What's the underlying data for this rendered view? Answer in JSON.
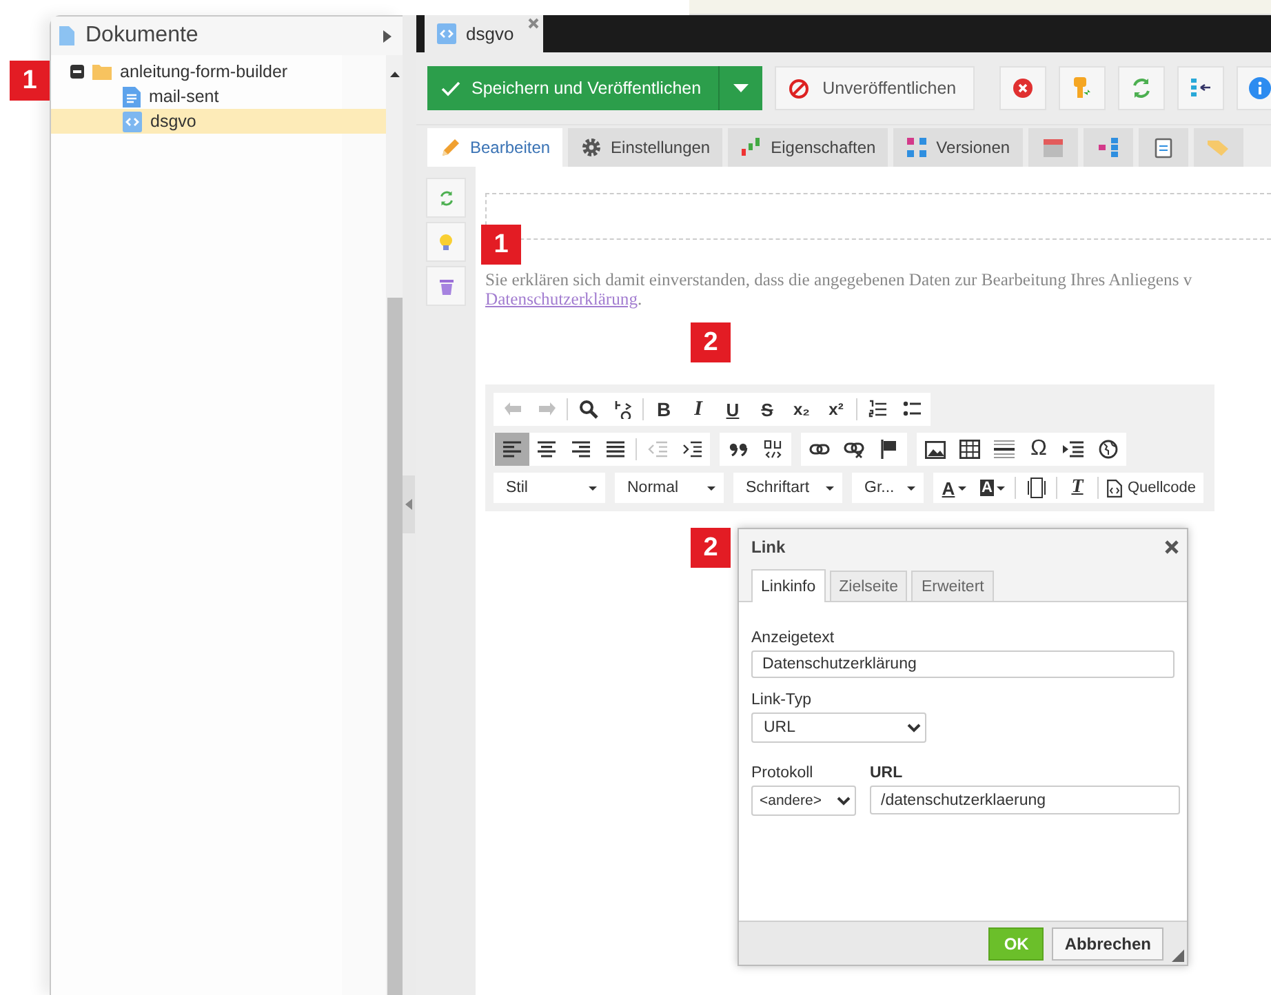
{
  "sidebar": {
    "title": "Dokumente",
    "tree": [
      {
        "label": "anleitung-form-builder",
        "kind": "folder",
        "expanded": true,
        "selected": false,
        "children": [
          {
            "label": "mail-sent",
            "kind": "page",
            "selected": false
          },
          {
            "label": "dsgvo",
            "kind": "snippet",
            "selected": true
          }
        ]
      }
    ]
  },
  "document_tabs": [
    {
      "label": "dsgvo",
      "kind": "snippet",
      "selected": true
    }
  ],
  "toolbar": {
    "save": "Speichern und Veröffentlichen",
    "unpublish": "Unveröffentlichen"
  },
  "tabs": [
    {
      "label": "Bearbeiten",
      "kind": "pencil",
      "selected": true
    },
    {
      "label": "Einstellungen",
      "kind": "gear",
      "selected": false
    },
    {
      "label": "Eigenschaften",
      "kind": "properties",
      "selected": false
    },
    {
      "label": "Versionen",
      "kind": "versions",
      "selected": false
    },
    {
      "kind": "calendar",
      "selected": false
    },
    {
      "kind": "hierarchy",
      "selected": false
    },
    {
      "kind": "clipboard",
      "selected": false
    },
    {
      "kind": "tag",
      "selected": false
    }
  ],
  "editor": {
    "text": "Sie erklären sich damit einverstanden, dass die angegebenen Daten zur Bearbeitung Ihres Anliegens v",
    "link": "Datenschutzerklärung",
    "after": ".",
    "toolbar_rows": [
      {
        "strips": [
          {
            "sections": [
              [
                {
                  "kind": "undo",
                  "disabled": true,
                  "selected": false
                },
                {
                  "kind": "redo",
                  "disabled": true,
                  "selected": false
                }
              ],
              [
                {
                  "kind": "find",
                  "disabled": false,
                  "selected": false
                },
                {
                  "kind": "replace",
                  "disabled": false,
                  "selected": false
                }
              ],
              [
                {
                  "kind": "bold",
                  "glyph": "B",
                  "disabled": false,
                  "selected": false
                },
                {
                  "kind": "italic",
                  "glyph": "I",
                  "disabled": false,
                  "selected": false
                },
                {
                  "kind": "underline",
                  "glyph": "U",
                  "disabled": false,
                  "selected": false
                },
                {
                  "kind": "strike",
                  "glyph": "S",
                  "disabled": false,
                  "selected": false
                },
                {
                  "kind": "subscript",
                  "glyph": "x₂",
                  "disabled": false,
                  "selected": false
                },
                {
                  "kind": "superscript",
                  "glyph": "x²",
                  "disabled": false,
                  "selected": false
                }
              ],
              [
                {
                  "kind": "numbered-list",
                  "disabled": false,
                  "selected": false
                },
                {
                  "kind": "bullet-list",
                  "disabled": false,
                  "selected": false
                }
              ]
            ]
          }
        ]
      },
      {
        "strips": [
          {
            "sections": [
              [
                {
                  "kind": "align-left",
                  "disabled": false,
                  "selected": true
                },
                {
                  "kind": "align-center",
                  "disabled": false,
                  "selected": false
                },
                {
                  "kind": "align-right",
                  "disabled": false,
                  "selected": false
                },
                {
                  "kind": "justify",
                  "disabled": false,
                  "selected": false
                }
              ],
              [
                {
                  "kind": "outdent",
                  "disabled": true,
                  "selected": false
                },
                {
                  "kind": "indent",
                  "disabled": false,
                  "selected": false
                }
              ]
            ]
          },
          {
            "sections": [
              [
                {
                  "kind": "blockquote",
                  "disabled": false,
                  "selected": false
                },
                {
                  "kind": "div",
                  "disabled": false,
                  "selected": false
                }
              ]
            ]
          },
          {
            "sections": [
              [
                {
                  "kind": "link",
                  "disabled": false,
                  "selected": false
                },
                {
                  "kind": "unlink",
                  "disabled": false,
                  "selected": false
                },
                {
                  "kind": "anchor",
                  "disabled": false,
                  "selected": false
                }
              ]
            ]
          },
          {
            "sections": [
              [
                {
                  "kind": "image",
                  "disabled": false,
                  "selected": false
                },
                {
                  "kind": "table",
                  "disabled": false,
                  "selected": false
                },
                {
                  "kind": "rule",
                  "disabled": false,
                  "selected": false
                },
                {
                  "kind": "special",
                  "glyph": "Ω",
                  "disabled": false,
                  "selected": false
                },
                {
                  "kind": "blocks",
                  "disabled": false,
                  "selected": false
                },
                {
                  "kind": "globe",
                  "disabled": false,
                  "selected": false
                }
              ]
            ]
          }
        ]
      },
      {
        "strips": [
          {
            "sections": [
              [
                {
                  "kind": "combo",
                  "label": "Stil"
                }
              ]
            ]
          },
          {
            "sections": [
              [
                {
                  "kind": "combo",
                  "label": "Normal"
                }
              ]
            ]
          },
          {
            "sections": [
              [
                {
                  "kind": "combo",
                  "label": "Schriftart"
                }
              ]
            ]
          },
          {
            "sections": [
              [
                {
                  "kind": "combo",
                  "label": "Gr..."
                }
              ]
            ]
          },
          {
            "sections": [
              [
                {
                  "kind": "text-color",
                  "glyph": "A",
                  "disabled": false,
                  "selected": false
                },
                {
                  "kind": "bg-color",
                  "glyph": "A",
                  "disabled": false,
                  "selected": false
                }
              ],
              [
                {
                  "kind": "maximize",
                  "disabled": false,
                  "selected": false
                }
              ],
              [
                {
                  "kind": "remove-format",
                  "glyph": "T",
                  "disabled": false,
                  "selected": false
                }
              ],
              [
                {
                  "kind": "source",
                  "label": "Quellcode",
                  "disabled": false,
                  "selected": false
                }
              ]
            ]
          }
        ]
      }
    ]
  },
  "markers": [
    {
      "label": "1"
    },
    {
      "label": "1"
    },
    {
      "label": "2"
    },
    {
      "label": "2"
    }
  ],
  "dialog": {
    "title": "Link",
    "tabs": [
      {
        "label": "Linkinfo",
        "selected": true
      },
      {
        "label": "Zielseite",
        "selected": false
      },
      {
        "label": "Erweitert",
        "selected": false
      }
    ],
    "display_text_label": "Anzeigetext",
    "display_text": "Datenschutzerklärung",
    "link_type_label": "Link-Typ",
    "link_type": "URL",
    "protocol_label": "Protokoll",
    "protocol": "<andere>",
    "url_label": "URL",
    "url": "/datenschutzerklaerung",
    "ok": "OK",
    "cancel": "Abbrechen"
  }
}
